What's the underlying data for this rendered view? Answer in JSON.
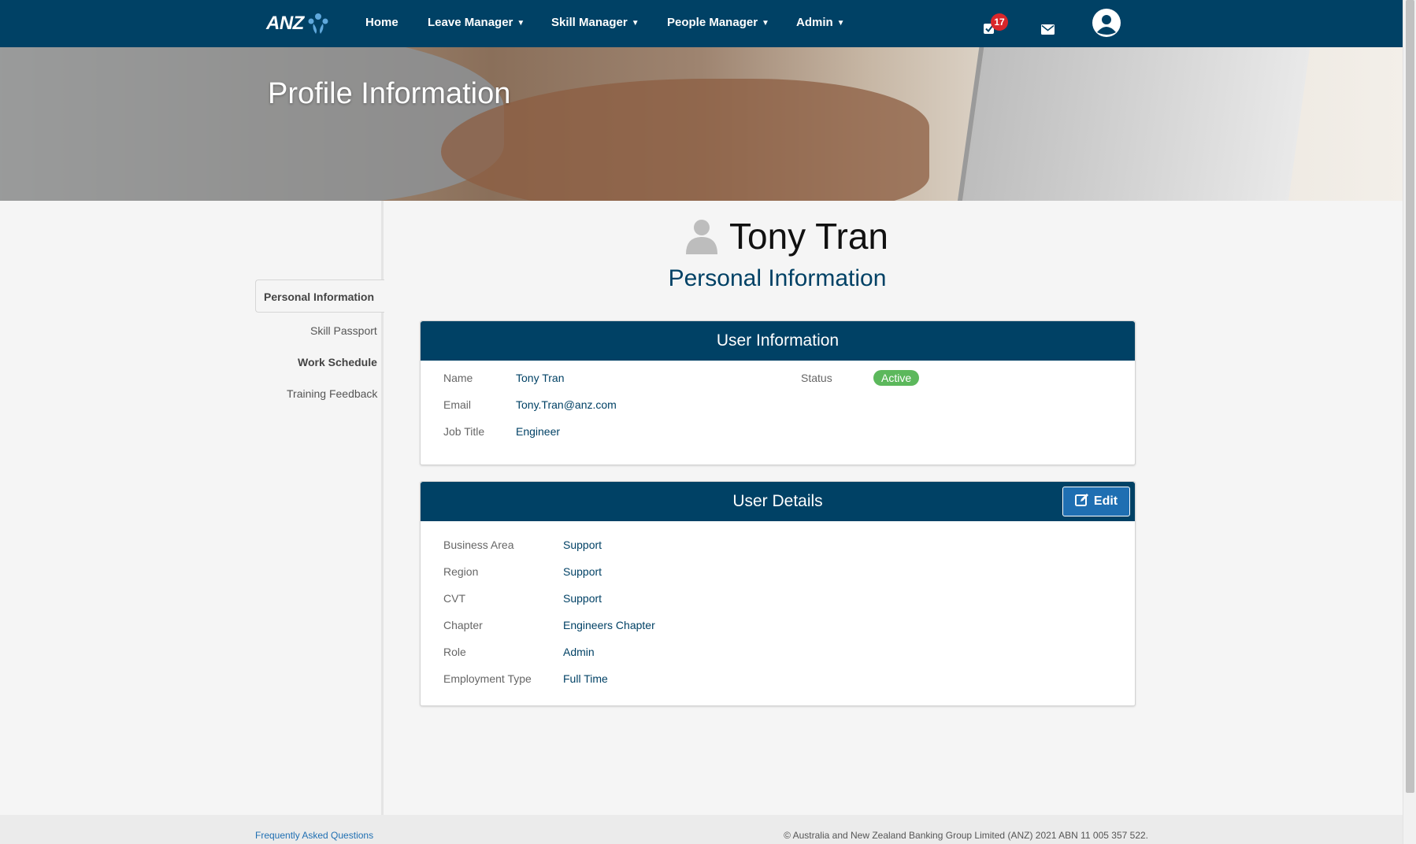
{
  "nav": {
    "logo_text": "ANZ",
    "items": [
      {
        "label": "Home",
        "dropdown": false
      },
      {
        "label": "Leave Manager",
        "dropdown": true
      },
      {
        "label": "Skill Manager",
        "dropdown": true
      },
      {
        "label": "People Manager",
        "dropdown": true
      },
      {
        "label": "Admin",
        "dropdown": true
      }
    ],
    "task_count": "17",
    "icons": [
      "tasks-icon",
      "mail-icon",
      "user-avatar-icon"
    ]
  },
  "hero": {
    "title": "Profile Information"
  },
  "sidebar": {
    "items": [
      "Personal Information",
      "Skill Passport",
      "Work Schedule",
      "Training Feedback"
    ],
    "active": "Personal Information"
  },
  "profile": {
    "name": "Tony Tran",
    "section_title": "Personal Information"
  },
  "user_information": {
    "title": "User Information",
    "fields": [
      {
        "label": "Name",
        "value": "Tony Tran"
      },
      {
        "label": "Email",
        "value": "Tony.Tran@anz.com"
      },
      {
        "label": "Job Title",
        "value": "Engineer"
      }
    ],
    "status_label": "Status",
    "status_value": "Active"
  },
  "user_details": {
    "title": "User Details",
    "edit_label": "Edit",
    "fields": [
      {
        "label": "Business Area",
        "value": "Support"
      },
      {
        "label": "Region",
        "value": "Support"
      },
      {
        "label": "CVT",
        "value": "Support"
      },
      {
        "label": "Chapter",
        "value": "Engineers Chapter"
      },
      {
        "label": "Role",
        "value": "Admin"
      },
      {
        "label": "Employment Type",
        "value": "Full Time"
      }
    ]
  },
  "footer": {
    "faq": "Frequently Asked Questions",
    "copyright": "© Australia and New Zealand Banking Group Limited (ANZ) 2021 ABN 11 005 357 522."
  },
  "colors": {
    "brand": "#004165",
    "accent": "#1f6fb2",
    "status_active": "#5cb85c",
    "badge": "#d9262a"
  }
}
